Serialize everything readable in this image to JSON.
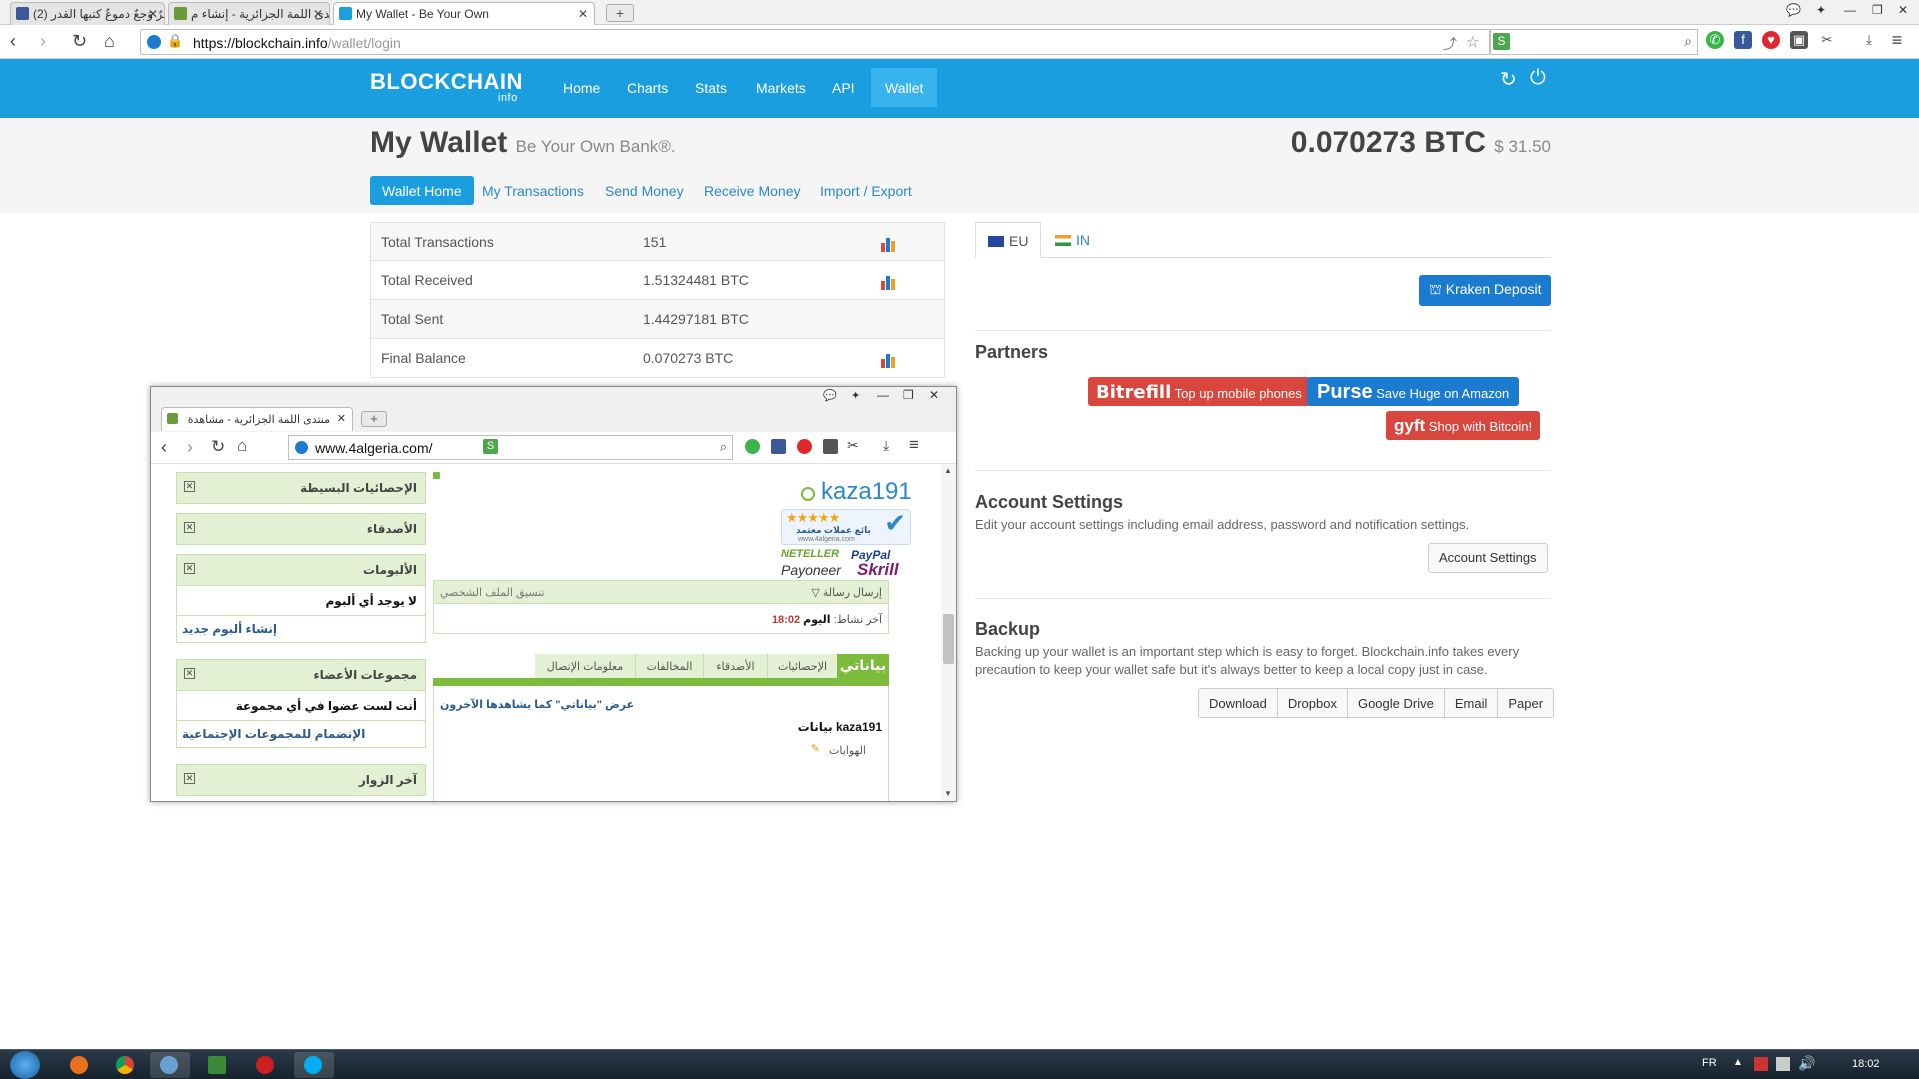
{
  "browser": {
    "tabs": [
      {
        "label": "(2) عطرٌ وَجعٌ دموعٌ كتبها القدر"
      },
      {
        "label": "منتدى اللمة الجزائرية - إنشاء م"
      },
      {
        "label": "My Wallet - Be Your Own"
      }
    ],
    "url_main": "https://blockchain.info",
    "url_dim": "/wallet/login"
  },
  "header": {
    "logo": "BLOCKCHAIN",
    "logo_sub": "info",
    "nav": [
      {
        "label": "Home"
      },
      {
        "label": "Charts"
      },
      {
        "label": "Stats"
      },
      {
        "label": "Markets"
      },
      {
        "label": "API"
      },
      {
        "label": "Wallet"
      }
    ]
  },
  "wallet": {
    "title": "My Wallet",
    "subtitle": "Be Your Own Bank®.",
    "balance_btc": "0.070273 BTC",
    "balance_usd": "$ 31.50",
    "tabs": [
      {
        "label": "Wallet Home"
      },
      {
        "label": "My Transactions"
      },
      {
        "label": "Send Money"
      },
      {
        "label": "Receive Money"
      },
      {
        "label": "Import / Export"
      }
    ]
  },
  "stats": [
    {
      "label": "Total Transactions",
      "value": "151"
    },
    {
      "label": "Total Received",
      "value": "1.51324481 BTC"
    },
    {
      "label": "Total Sent",
      "value": "1.44297181 BTC"
    },
    {
      "label": "Final Balance",
      "value": "0.070273 BTC"
    }
  ],
  "region_tabs": [
    {
      "label": "EU"
    },
    {
      "label": "IN"
    }
  ],
  "kraken_button": "Kraken Deposit",
  "partners": {
    "heading": "Partners",
    "bitrefill_logo": "Bitrefill",
    "bitrefill_text": "Top up mobile phones",
    "purse_logo": "Purse",
    "purse_text": "Save Huge on Amazon",
    "gyft_logo": "gyft",
    "gyft_text": "Shop with Bitcoin!"
  },
  "account_settings": {
    "heading": "Account Settings",
    "desc": "Edit your account settings including email address, password and notification settings.",
    "button": "Account Settings"
  },
  "backup": {
    "heading": "Backup",
    "desc_line1": "Backing up your wallet is an important step which is easy to forget. Blockchain.info takes every",
    "desc_line2": "precaution to keep your wallet safe but it's always better to keep a local copy just in case.",
    "buttons": [
      {
        "label": "Download"
      },
      {
        "label": "Dropbox"
      },
      {
        "label": "Google Drive"
      },
      {
        "label": "Email"
      },
      {
        "label": "Paper"
      }
    ]
  },
  "popup": {
    "tab_title": "منتدى اللمة الجزائرية - مشاهدة",
    "url": "www.4algeria.com/",
    "username": "kaza191",
    "side_boxes": [
      {
        "title": "الإحصائيات البسيطة"
      },
      {
        "title": "الأصدقاء"
      },
      {
        "title": "الألبومات",
        "body": "لا يوجد أي ألبوم",
        "link": "إنشاء ألبوم جديد"
      },
      {
        "title": "مجموعات الأعضاء",
        "body": "أنت لست عضوا في أي مجموعة",
        "link": "الإنضمام للمجموعات الإجتماعية"
      },
      {
        "title": "آخر الزوار"
      }
    ],
    "send_message": "إرسال رسالة",
    "profile_format": "تنسيق الملف الشخصي",
    "last_activity_label": "آخر نشاط:",
    "last_activity_day": "اليوم",
    "last_activity_time": "18:02",
    "profile_tabs": [
      {
        "label": "بياناتي"
      },
      {
        "label": "الإحصائيات"
      },
      {
        "label": "الأصدقاء"
      },
      {
        "label": "المخالفات"
      },
      {
        "label": "معلومات الإتصال"
      }
    ],
    "view_as_others": "عرض \"بياناتي\" كما يشاهدها الآخرون",
    "data_of": "بيانات kaza191",
    "hobbies": "الهوايات",
    "badge_text": "بائع عملات معتمد",
    "badge_site": "www.4algeria.com",
    "logos": {
      "neteller": "NETELLER",
      "paypal": "PayPal",
      "payoneer": "Payoneer",
      "skrill": "Skrill"
    }
  },
  "taskbar": {
    "lang": "FR",
    "time": "18:02"
  },
  "colors": {
    "brand_blue": "#1a9ee0",
    "accent_green": "#7dbb3c",
    "partner_red": "#d9463e"
  }
}
